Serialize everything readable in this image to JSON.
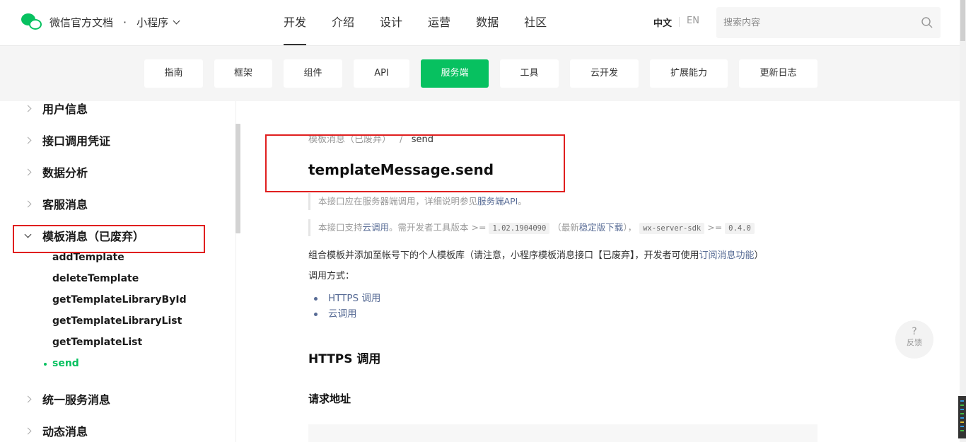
{
  "header": {
    "brand": "微信官方文档",
    "separator": "·",
    "product": "小程序",
    "nav": [
      "开发",
      "介绍",
      "设计",
      "运营",
      "数据",
      "社区"
    ],
    "active_nav": "开发",
    "lang_zh": "中文",
    "lang_en": "EN",
    "search_placeholder": "搜索内容"
  },
  "subnav": {
    "items": [
      "指南",
      "框架",
      "组件",
      "API",
      "服务端",
      "工具",
      "云开发",
      "扩展能力",
      "更新日志"
    ],
    "active": "服务端"
  },
  "sidebar": {
    "groups_before": [
      "用户信息",
      "接口调用凭证",
      "数据分析",
      "客服消息"
    ],
    "open_group": "模板消息（已废弃）",
    "open_group_items": [
      "addTemplate",
      "deleteTemplate",
      "getTemplateLibraryById",
      "getTemplateLibraryList",
      "getTemplateList",
      "send"
    ],
    "current_item": "send",
    "groups_after": [
      "统一服务消息",
      "动态消息"
    ]
  },
  "content": {
    "breadcrumb_parent": "模板消息（已废弃）",
    "breadcrumb_sep": "/",
    "breadcrumb_current": "send",
    "title": "templateMessage.send",
    "note1_prefix": "本接口应在服务器端调用，详细说明参见",
    "note1_link": "服务端API",
    "note1_suffix": "。",
    "note2_prefix": "本接口支持",
    "note2_link": "云调用",
    "note2_mid": "。需开发者工具版本 >=",
    "note2_version": "1.02.1904090",
    "note2_paren_open": "（最新",
    "note2_download": "稳定版下载",
    "note2_paren_close": "），",
    "note2_sdk": "wx-server-sdk",
    "note2_gte": ">=",
    "note2_sdk_version": "0.4.0",
    "desc_prefix": "组合模板并添加至帐号下的个人模板库（请注意，小程序模板消息接口【已废弃】，开发者可使用",
    "desc_link": "订阅消息功能",
    "desc_suffix": "）",
    "call_methods_label": "调用方式：",
    "call_methods": [
      "HTTPS 调用",
      "云调用"
    ],
    "section_https": "HTTPS 调用",
    "section_request_url": "请求地址"
  },
  "feedback": {
    "icon": "?",
    "label": "反馈"
  },
  "colors": {
    "accent": "#07c160",
    "link": "#576b95",
    "highlight": "#e01f1f"
  }
}
